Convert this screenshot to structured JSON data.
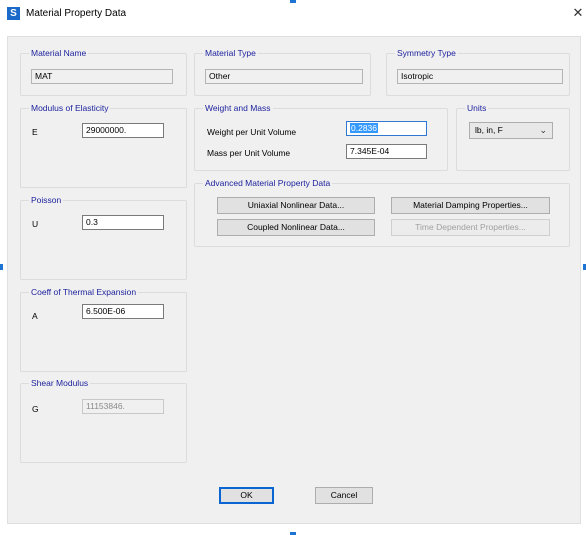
{
  "window": {
    "title": "Material Property Data",
    "app_icon": "S",
    "close_glyph": "✕"
  },
  "material_name": {
    "group_title": "Material Name",
    "value": "MAT"
  },
  "material_type": {
    "group_title": "Material Type",
    "value": "Other"
  },
  "symmetry_type": {
    "group_title": "Symmetry Type",
    "value": "Isotropic"
  },
  "elasticity": {
    "group_title": "Modulus of Elasticity",
    "label": "E",
    "value": "29000000."
  },
  "weight_mass": {
    "group_title": "Weight and Mass",
    "weight_label": "Weight per Unit Volume",
    "weight_value": "0.2836",
    "mass_label": "Mass per Unit Volume",
    "mass_value": "7.345E-04"
  },
  "units": {
    "group_title": "Units",
    "value": "lb, in, F"
  },
  "advanced": {
    "group_title": "Advanced Material Property Data",
    "uniaxial": "Uniaxial Nonlinear Data...",
    "damping": "Material Damping Properties...",
    "coupled": "Coupled Nonlinear Data...",
    "time_dep": "Time Dependent Properties..."
  },
  "poisson": {
    "group_title": "Poisson",
    "label": "U",
    "value": "0.3"
  },
  "thermal": {
    "group_title": "Coeff of Thermal Expansion",
    "label": "A",
    "value": "6.500E-06"
  },
  "shear": {
    "group_title": "Shear Modulus",
    "label": "G",
    "value": "11153846."
  },
  "footer": {
    "ok": "OK",
    "cancel": "Cancel"
  },
  "colors": {
    "group_title": "#1a1f9c",
    "selection": "#3399ff",
    "app_icon": "#1b6ac9",
    "focus_border": "#0a64d2"
  }
}
